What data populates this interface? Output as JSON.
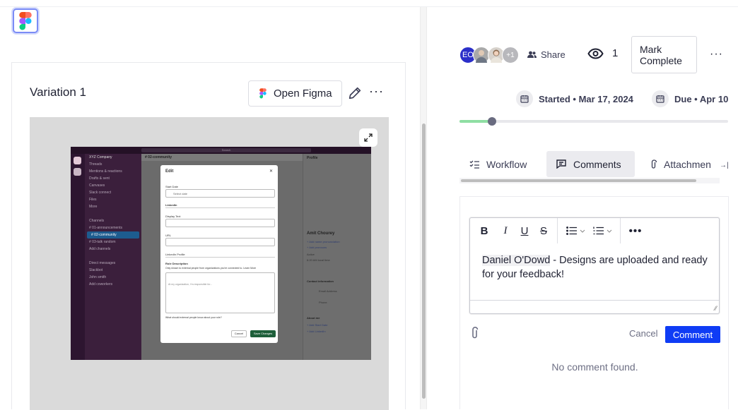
{
  "left": {
    "variation_title": "Variation 1",
    "open_figma_label": "Open Figma",
    "more_label": "···",
    "preview": {
      "channel": "# 02-community",
      "search": "Search",
      "workspace": "XYZ Company",
      "sidebar_items": [
        "Threads",
        "Mentions & reactions",
        "Drafts & sent",
        "Canvases",
        "Slack connect",
        "Files",
        "More",
        "",
        "Channels",
        "# 01-announcements",
        "# 02-community",
        "# 03-talk random",
        "Add channels",
        "",
        "Direct messages",
        "Slackbot",
        "John smith",
        "Add coworkers"
      ],
      "active_item_index": 10,
      "profile_title": "Profile",
      "profile_name": "Amit Chourey",
      "profile_links": [
        "+ Add name pronunciation",
        "+ Add pronouns",
        "Active",
        "6:20 AM local time",
        "Contact information",
        "Email Address",
        "Phone",
        "About me",
        "+ Add Start Date",
        "+ Add LinkedIn"
      ],
      "modal": {
        "title": "Edit",
        "start_date_label": "Start Date",
        "start_date_placeholder": "Select date",
        "linkedin_section": "LinkedIn",
        "display_text_label": "Display Text",
        "url_label": "URL",
        "linkedin_profile_label": "LinkedIn Profile",
        "role_description_label": "Role Description",
        "role_hint": "Only shown to external people from organizations you're connected to. Learn More",
        "role_placeholder": "At my organization, I'm responsible for...",
        "role_question": "What should external people know about your role?",
        "cancel": "Cancel",
        "save": "Save Changes"
      }
    }
  },
  "right": {
    "avatars": [
      {
        "initials": "EO",
        "color": "#2b2fc9"
      },
      {
        "initials": "",
        "color": "#a9a9a9"
      },
      {
        "initials": "",
        "color": "#c4b3a0"
      },
      {
        "initials": "+1",
        "color": "#b8b8bc"
      }
    ],
    "share_label": "Share",
    "watchers_count": "1",
    "mark_complete_label": "Mark Complete",
    "more_label": "···",
    "started_label": "Started • Mar 17, 2024",
    "due_label": "Due • Apr 10",
    "progress_fraction": 0.12,
    "tabs": [
      {
        "label": "Workflow",
        "icon": "workflow-icon",
        "active": false
      },
      {
        "label": "Comments",
        "icon": "comment-icon",
        "active": true
      },
      {
        "label": "Attachmen",
        "icon": "paperclip-icon",
        "active": false
      }
    ],
    "editor": {
      "toolbar": [
        "B",
        "I",
        "U",
        "S"
      ],
      "mention": "Daniel O'Dowd",
      "body": " - Designs are uploaded and ready for your feedback!"
    },
    "cancel_label": "Cancel",
    "comment_label": "Comment",
    "empty_text": "No comment found."
  }
}
